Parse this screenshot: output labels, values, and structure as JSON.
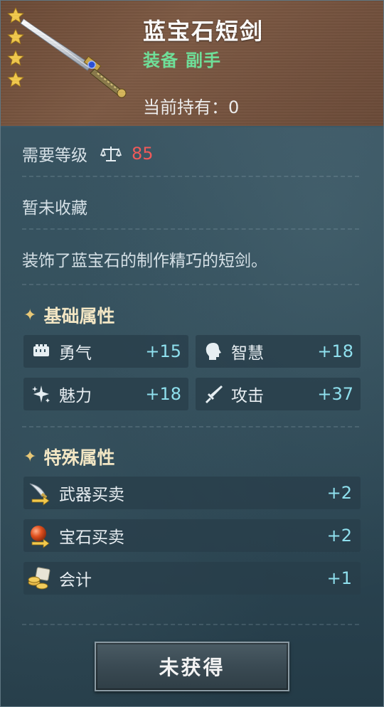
{
  "item": {
    "name": "蓝宝石短剑",
    "type_category": "装备",
    "type_slot": "副手",
    "owned_label": "当前持有：",
    "owned_value": "0",
    "stars": 4,
    "sword_icon": "sapphire-shortsword-icon"
  },
  "requirement": {
    "label": "需要等级",
    "icon": "balance-scale-icon",
    "value": "85",
    "value_color": "#f05a5a"
  },
  "collection_status": "暂未收藏",
  "description": "装饰了蓝宝石的制作精巧的短剑。",
  "base_attributes": {
    "title": "基础属性",
    "items": [
      {
        "name": "勇气",
        "value": "+15",
        "icon": "courage-icon"
      },
      {
        "name": "智慧",
        "value": "+18",
        "icon": "wisdom-head-icon"
      },
      {
        "name": "魅力",
        "value": "+18",
        "icon": "charm-sparkle-icon"
      },
      {
        "name": "攻击",
        "value": "+37",
        "icon": "attack-sword-icon"
      }
    ]
  },
  "special_attributes": {
    "title": "特殊属性",
    "items": [
      {
        "name": "武器买卖",
        "value": "+2",
        "icon": "weapon-trade-icon"
      },
      {
        "name": "宝石买卖",
        "value": "+2",
        "icon": "gem-trade-icon"
      },
      {
        "name": "会计",
        "value": "+1",
        "icon": "accounting-coins-icon"
      }
    ]
  },
  "action_button": "未获得",
  "colors": {
    "accent_value": "#8fe0ee",
    "slot_green": "#6fe29a",
    "header_brown": "#7d5a44",
    "star_gold": "#f2c94c"
  }
}
